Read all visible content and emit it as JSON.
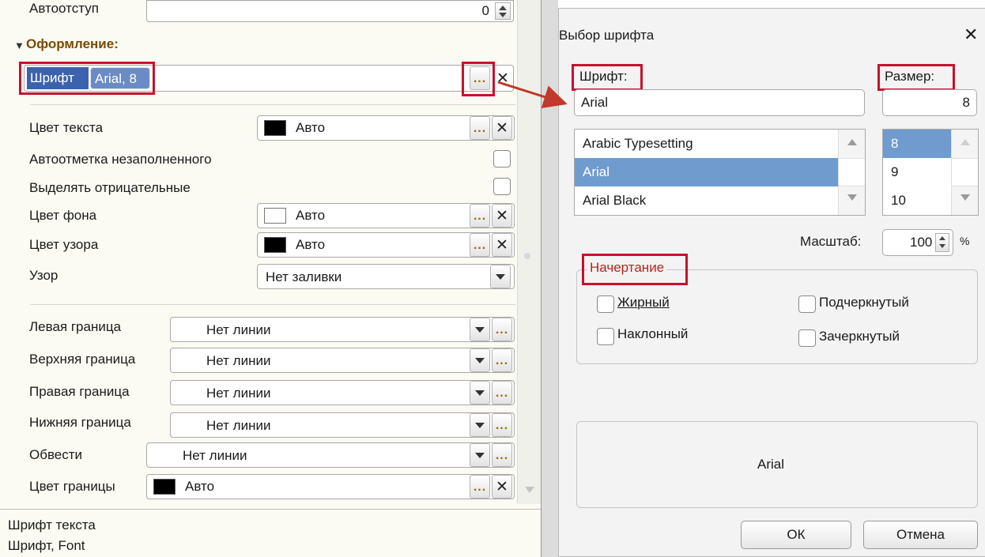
{
  "left": {
    "rows": {
      "autoindent_label": "Автоотступ",
      "autoindent_value": "0",
      "section_title": "Оформление:",
      "font_label": "Шрифт",
      "font_value": "Arial, 8",
      "text_color_label": "Цвет текста",
      "text_color_value": "Авто",
      "autofill_label": "Автоотметка незаполненного",
      "negative_label": "Выделять отрицательные",
      "bg_color_label": "Цвет фона",
      "bg_color_value": "Авто",
      "pattern_color_label": "Цвет узора",
      "pattern_color_value": "Авто",
      "pattern_label": "Узор",
      "pattern_value": "Нет заливки",
      "left_border_label": "Левая граница",
      "left_border_value": "Нет линии",
      "top_border_label": "Верхняя граница",
      "top_border_value": "Нет линии",
      "right_border_label": "Правая граница",
      "right_border_value": "Нет линии",
      "bottom_border_label": "Нижняя граница",
      "bottom_border_value": "Нет линии",
      "outline_label": "Обвести",
      "outline_value": "Нет линии",
      "border_color_label": "Цвет границы",
      "border_color_value": "Авто"
    },
    "footer": {
      "line1": "Шрифт текста",
      "line2": "Шрифт, Font"
    }
  },
  "dialog": {
    "title": "Выбор шрифта",
    "close_glyph": "✕",
    "font_label": "Шрифт:",
    "font_value": "Arial",
    "size_label": "Размер:",
    "size_value": "8",
    "font_list": [
      "Arabic Typesetting",
      "Arial",
      "Arial Black"
    ],
    "font_selected": "Arial",
    "size_list": [
      "8",
      "9",
      "10"
    ],
    "size_selected": "8",
    "scale_label": "Масштаб:",
    "scale_value": "100",
    "scale_unit": "%",
    "style_group": "Начертание",
    "bold": "Жирный",
    "italic": "Наклонный",
    "underline": "Подчеркнутый",
    "strikeout": "Зачеркнутый",
    "preview_text": "Arial",
    "ok_label": "ОК",
    "cancel_label": "Отмена"
  },
  "colors": {
    "highlight": "#c8102e",
    "selection": "#6f9bcf",
    "swatch_black": "#000000"
  }
}
